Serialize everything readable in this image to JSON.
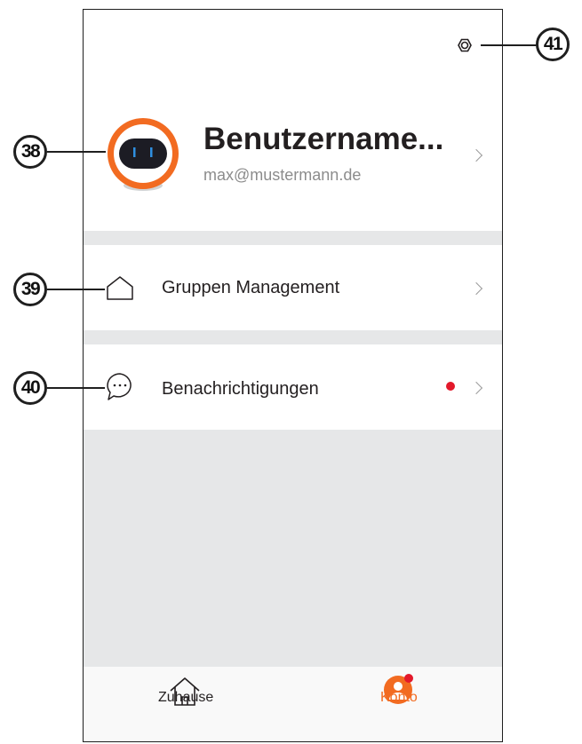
{
  "profile": {
    "username": "Benutzername...",
    "email": "max@mustermann.de"
  },
  "menu": {
    "groups_label": "Gruppen Management",
    "notifications_label": "Benachrichtigungen"
  },
  "tabs": {
    "home_label": "Zuhause",
    "account_label": "Konto"
  },
  "callouts": {
    "avatar": "38",
    "groups": "39",
    "notifications": "40",
    "settings": "41"
  },
  "colors": {
    "accent": "#f26b21",
    "badge": "#e3192b",
    "separator": "#e6e7e8"
  },
  "icons": [
    "settings-gear-icon",
    "home-outline-icon",
    "chat-bubble-icon",
    "house-tab-icon",
    "person-tab-icon"
  ]
}
